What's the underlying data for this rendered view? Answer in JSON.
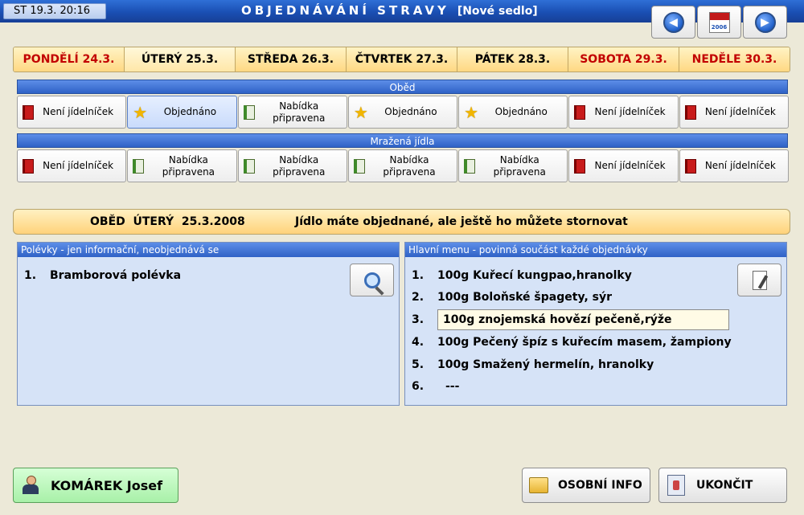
{
  "header": {
    "clock": "ST 19.3. 20:16",
    "title": "OBJEDNÁVÁNÍ STRAVY",
    "subtitle": "[Nové sedlo]",
    "calendar_year": "2006"
  },
  "days": [
    {
      "label": "PONDĚLÍ 24.3.",
      "color": "#c20000"
    },
    {
      "label": "ÚTERÝ 25.3.",
      "color": "#000000"
    },
    {
      "label": "STŘEDA 26.3.",
      "color": "#000000"
    },
    {
      "label": "ČTVRTEK 27.3.",
      "color": "#000000"
    },
    {
      "label": "PÁTEK 28.3.",
      "color": "#000000"
    },
    {
      "label": "SOBOTA 29.3.",
      "color": "#c20000"
    },
    {
      "label": "NEDĚLE 30.3.",
      "color": "#c20000"
    }
  ],
  "obed": {
    "header": "Oběd",
    "cells": [
      {
        "icon": "red-book-icon",
        "text": "Není jídelníček"
      },
      {
        "icon": "star-icon",
        "text": "Objednáno"
      },
      {
        "icon": "green-book-icon",
        "text": "Nabídka připravena"
      },
      {
        "icon": "star-icon",
        "text": "Objednáno"
      },
      {
        "icon": "star-icon",
        "text": "Objednáno"
      },
      {
        "icon": "red-book-icon",
        "text": "Není jídelníček"
      },
      {
        "icon": "red-book-icon",
        "text": "Není jídelníček"
      }
    ]
  },
  "mrazena": {
    "header": "Mražená jídla",
    "cells": [
      {
        "icon": "red-book-icon",
        "text": "Není jídelníček"
      },
      {
        "icon": "green-book-icon",
        "text": "Nabídka připravena"
      },
      {
        "icon": "green-book-icon",
        "text": "Nabídka připravena"
      },
      {
        "icon": "green-book-icon",
        "text": "Nabídka připravena"
      },
      {
        "icon": "green-book-icon",
        "text": "Nabídka připravena"
      },
      {
        "icon": "red-book-icon",
        "text": "Není jídelníček"
      },
      {
        "icon": "red-book-icon",
        "text": "Není jídelníček"
      }
    ]
  },
  "banner": {
    "left": "OBĚD  ÚTERÝ  25.3.2008",
    "right": "Jídlo máte objednané, ale ještě ho můžete stornovat"
  },
  "soups": {
    "header": "Polévky - jen informační, neobjednává se",
    "items": [
      {
        "num": "1.",
        "text": "Bramborová polévka"
      }
    ]
  },
  "main_menu": {
    "header": "Hlavní menu - povinná součást každé objednávky",
    "items": [
      {
        "num": "1.",
        "text": "100g Kuřecí kungpao,hranolky"
      },
      {
        "num": "2.",
        "text": "100g Boloňské špagety, sýr"
      },
      {
        "num": "3.",
        "text": "100g znojemská hovězí pečeně,rýže"
      },
      {
        "num": "4.",
        "text": "100g Pečený špíz s kuřecím masem, žampiony"
      },
      {
        "num": "5.",
        "text": "100g Smažený hermelín, hranolky"
      },
      {
        "num": "6.",
        "text": "---"
      }
    ],
    "selected_index": 2
  },
  "footer": {
    "user": "KOMÁREK Josef",
    "info_button": "OSOBNÍ INFO",
    "exit_button": "UKONČIT"
  }
}
